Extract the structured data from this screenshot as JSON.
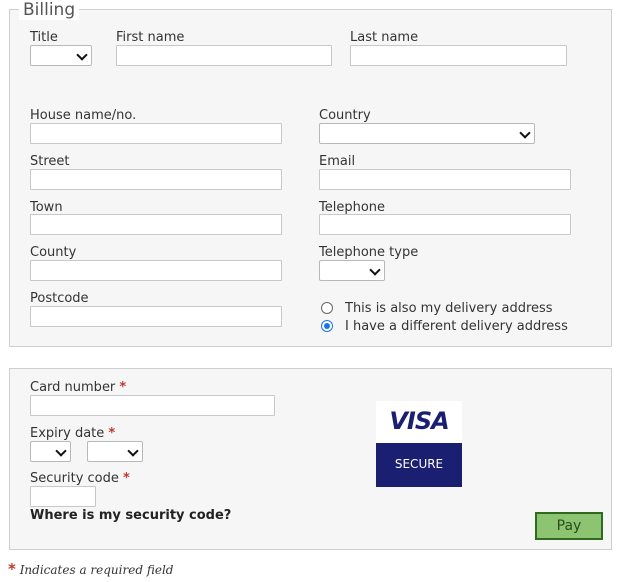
{
  "billing": {
    "legend": "Billing",
    "title_label": "Title",
    "first_name_label": "First name",
    "last_name_label": "Last name",
    "house_label": "House name/no.",
    "country_label": "Country",
    "street_label": "Street",
    "email_label": "Email",
    "town_label": "Town",
    "telephone_label": "Telephone",
    "county_label": "County",
    "telephone_type_label": "Telephone type",
    "postcode_label": "Postcode",
    "delivery_same_label": "This is also my delivery address",
    "delivery_different_label": "I have a different delivery address",
    "selected_delivery_option": "I have a different delivery address"
  },
  "payment": {
    "card_number_label": "Card number",
    "expiry_date_label": "Expiry date",
    "security_code_label": "Security code",
    "required_marker": "*",
    "security_code_help": "Where is my security code?",
    "visa_logo_text": "VISA",
    "visa_secure_text": "SECURE",
    "pay_button_label": "Pay"
  },
  "footnote": {
    "marker": "*",
    "text": "Indicates a required field"
  },
  "colors": {
    "required": "#c0392b",
    "pay_button_bg": "#8cc472",
    "pay_button_border": "#2e6b1f",
    "visa_blue": "#1a1f71",
    "radio_checked": "#1a73e8"
  }
}
